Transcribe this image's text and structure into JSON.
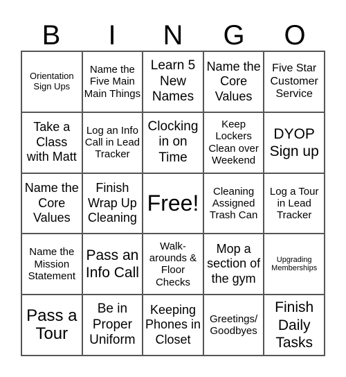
{
  "header": [
    "B",
    "I",
    "N",
    "G",
    "O"
  ],
  "cells": [
    "Orientation Sign Ups",
    "Name the Five Main Main Things",
    "Learn 5 New Names",
    "Name the Core Values",
    "Five Star Customer Service",
    "Take a Class with Matt",
    "Log an Info Call in Lead Tracker",
    "Clocking in on Time",
    "Keep Lockers Clean over Weekend",
    "DYOP Sign up",
    "Name the Core Values",
    "Finish Wrap Up Cleaning",
    "Free!",
    "Cleaning Assigned Trash Can",
    "Log a Tour in Lead Tracker",
    "Name the Mission Statement",
    "Pass an Info Call",
    "Walk-arounds & Floor Checks",
    "Mop a section of the gym",
    "Upgrading Memberships",
    "Pass a Tour",
    "Be in Proper Uniform",
    "Keeping Phones in Closet",
    "Greetings/ Goodbyes",
    "Finish Daily Tasks"
  ]
}
